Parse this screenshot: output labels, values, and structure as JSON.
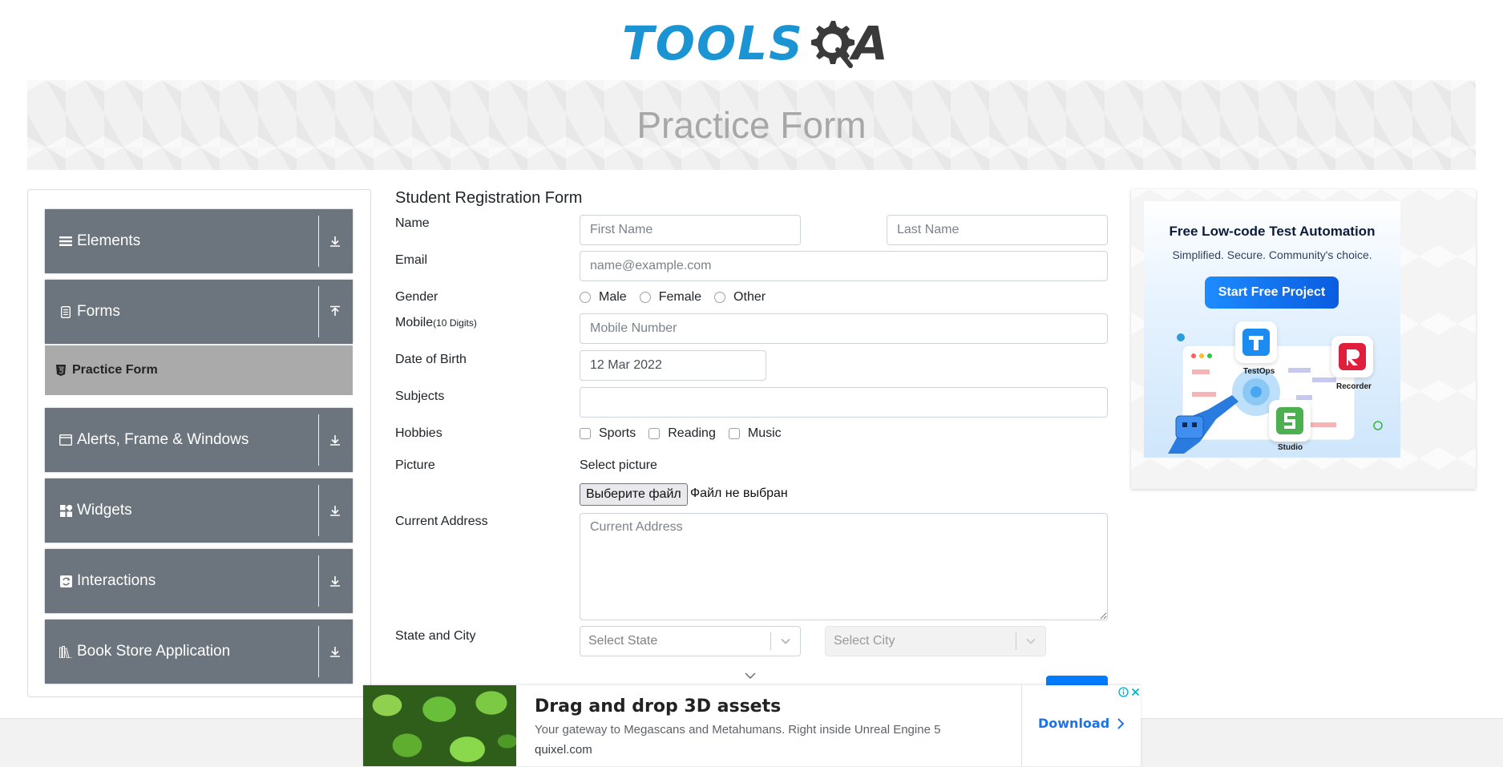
{
  "header": {
    "logo_tools": "TOOLS",
    "logo_qa": "A"
  },
  "banner": {
    "title": "Practice Form"
  },
  "sidebar": {
    "groups": [
      {
        "label": "Elements",
        "icon": "list-icon",
        "expanded": false
      },
      {
        "label": "Forms",
        "icon": "document-icon",
        "expanded": true
      },
      {
        "label": "Alerts, Frame & Windows",
        "icon": "window-icon",
        "expanded": false
      },
      {
        "label": "Widgets",
        "icon": "widgets-icon",
        "expanded": false
      },
      {
        "label": "Interactions",
        "icon": "interactions-icon",
        "expanded": false
      },
      {
        "label": "Book Store Application",
        "icon": "books-icon",
        "expanded": false
      }
    ],
    "active_item": {
      "label": "Practice Form",
      "icon": "html5-icon"
    }
  },
  "form": {
    "title": "Student Registration Form",
    "name_label": "Name",
    "first_name_placeholder": "First Name",
    "last_name_placeholder": "Last Name",
    "email_label": "Email",
    "email_placeholder": "name@example.com",
    "gender_label": "Gender",
    "gender_options": [
      "Male",
      "Female",
      "Other"
    ],
    "mobile_label": "Mobile",
    "mobile_hint": "(10 Digits)",
    "mobile_placeholder": "Mobile Number",
    "dob_label": "Date of Birth",
    "dob_value": "12 Mar 2022",
    "subjects_label": "Subjects",
    "subjects_value": "",
    "hobbies_label": "Hobbies",
    "hobbies_options": [
      "Sports",
      "Reading",
      "Music"
    ],
    "picture_label": "Picture",
    "picture_select_text": "Select picture",
    "file_button": "Выберите файл",
    "file_status": "Файл не выбран",
    "address_label": "Current Address",
    "address_placeholder": "Current Address",
    "state_city_label": "State and City",
    "state_placeholder": "Select State",
    "city_placeholder": "Select City"
  },
  "side_ad": {
    "title": "Free Low-code Test Automation",
    "subtitle": "Simplified. Secure. Community's choice.",
    "cta": "Start Free Project",
    "products": [
      "TestOps",
      "Recorder",
      "Studio"
    ]
  },
  "bottom_ad": {
    "headline": "Drag and drop 3D assets",
    "description": "Your gateway to Megascans and Metahumans. Right inside Unreal Engine 5",
    "domain": "quixel.com",
    "cta": "Download"
  },
  "colors": {
    "brand_blue": "#1a94d2",
    "sidebar_group": "#6c757d",
    "active_item": "#aaaaaa",
    "submit_blue": "#007bff",
    "ad_cta_blue": "#1a73e8"
  }
}
